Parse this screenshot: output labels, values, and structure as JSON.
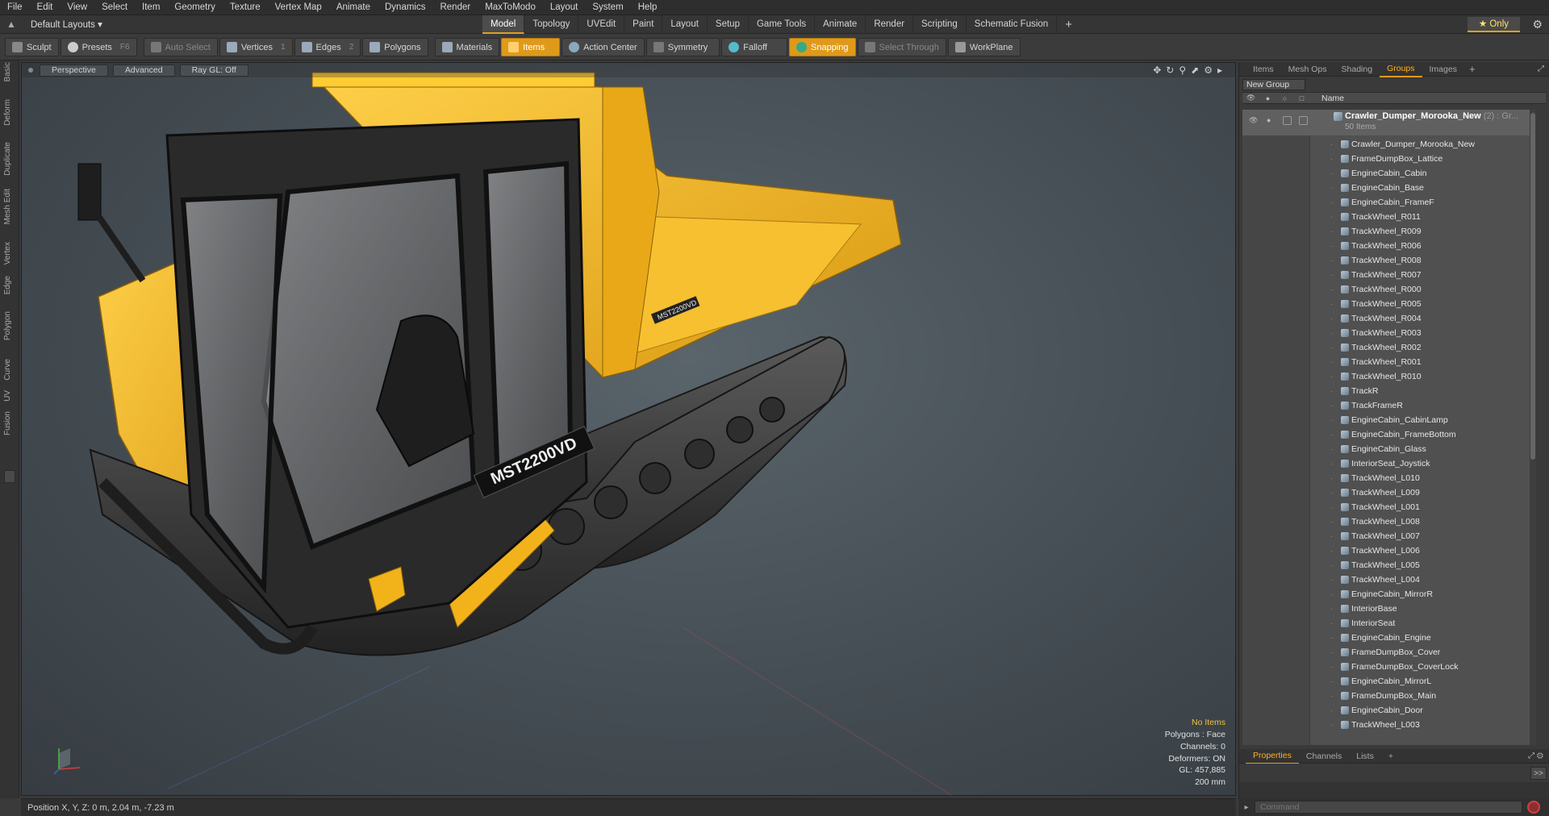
{
  "menu": [
    "File",
    "Edit",
    "View",
    "Select",
    "Item",
    "Geometry",
    "Texture",
    "Vertex Map",
    "Animate",
    "Dynamics",
    "Render",
    "MaxToModo",
    "Layout",
    "System",
    "Help"
  ],
  "layoutbar": {
    "layout_dropdown": "Default Layouts ▾",
    "tabs": [
      "Model",
      "Topology",
      "UVEdit",
      "Paint",
      "Layout",
      "Setup",
      "Game Tools",
      "Animate",
      "Render",
      "Scripting",
      "Schematic Fusion"
    ],
    "active_tab": "Model",
    "only_label": "★ Only"
  },
  "toolbar": {
    "sculpt": "Sculpt",
    "presets": "Presets",
    "presets_key": "F6",
    "auto_select": "Auto Select",
    "vertices": "Vertices",
    "vertices_count": "1",
    "edges": "Edges",
    "edges_count": "2",
    "polygons": "Polygons",
    "materials": "Materials",
    "items": "Items",
    "action_center": "Action Center",
    "symmetry": "Symmetry",
    "falloff": "Falloff",
    "snapping": "Snapping",
    "select_through": "Select Through",
    "workplane": "WorkPlane"
  },
  "left_tabs": [
    "Basic",
    "Deform",
    "Duplicate",
    "Mesh Edit",
    "Vertex",
    "Edge",
    "Polygon",
    "Curve",
    "UV",
    "Fusion"
  ],
  "viewport": {
    "view_mode": "Perspective",
    "shading": "Advanced",
    "raygl": "Ray GL: Off",
    "info": {
      "no_items": "No Items",
      "polygons": "Polygons : Face",
      "channels": "Channels: 0",
      "deformers": "Deformers: ON",
      "gl": "GL: 457,885",
      "scale": "200 mm"
    },
    "decal": "MST2200VD",
    "colors": {
      "body": "#f2b21a",
      "cab": "#2a2a2a",
      "track": "#3a3a3a"
    }
  },
  "status": {
    "position": "Position X, Y, Z:   0 m, 2.04 m, -7.23 m"
  },
  "right_panel": {
    "tabs": [
      "Items",
      "Mesh Ops",
      "Shading",
      "Groups",
      "Images"
    ],
    "active_tab": "Groups",
    "new_group": "New Group",
    "name_col": "Name",
    "group": {
      "name": "Crawler_Dumper_Morooka_New",
      "suffix": "(2) : Gr...",
      "count": "50 Items"
    },
    "items": [
      "Crawler_Dumper_Morooka_New",
      "FrameDumpBox_Lattice",
      "EngineCabin_Cabin",
      "EngineCabin_Base",
      "EngineCabin_FrameF",
      "TrackWheel_R011",
      "TrackWheel_R009",
      "TrackWheel_R006",
      "TrackWheel_R008",
      "TrackWheel_R007",
      "TrackWheel_R000",
      "TrackWheel_R005",
      "TrackWheel_R004",
      "TrackWheel_R003",
      "TrackWheel_R002",
      "TrackWheel_R001",
      "TrackWheel_R010",
      "TrackR",
      "TrackFrameR",
      "EngineCabin_CabinLamp",
      "EngineCabin_FrameBottom",
      "EngineCabin_Glass",
      "InteriorSeat_Joystick",
      "TrackWheel_L010",
      "TrackWheel_L009",
      "TrackWheel_L001",
      "TrackWheel_L008",
      "TrackWheel_L007",
      "TrackWheel_L006",
      "TrackWheel_L005",
      "TrackWheel_L004",
      "EngineCabin_MirrorR",
      "InteriorBase",
      "InteriorSeat",
      "EngineCabin_Engine",
      "FrameDumpBox_Cover",
      "FrameDumpBox_CoverLock",
      "EngineCabin_MirrorL",
      "FrameDumpBox_Main",
      "EngineCabin_Door",
      "TrackWheel_L003"
    ],
    "bottom_tabs": [
      "Properties",
      "Channels",
      "Lists"
    ],
    "bottom_active": "Properties",
    "command_placeholder": "Command"
  }
}
